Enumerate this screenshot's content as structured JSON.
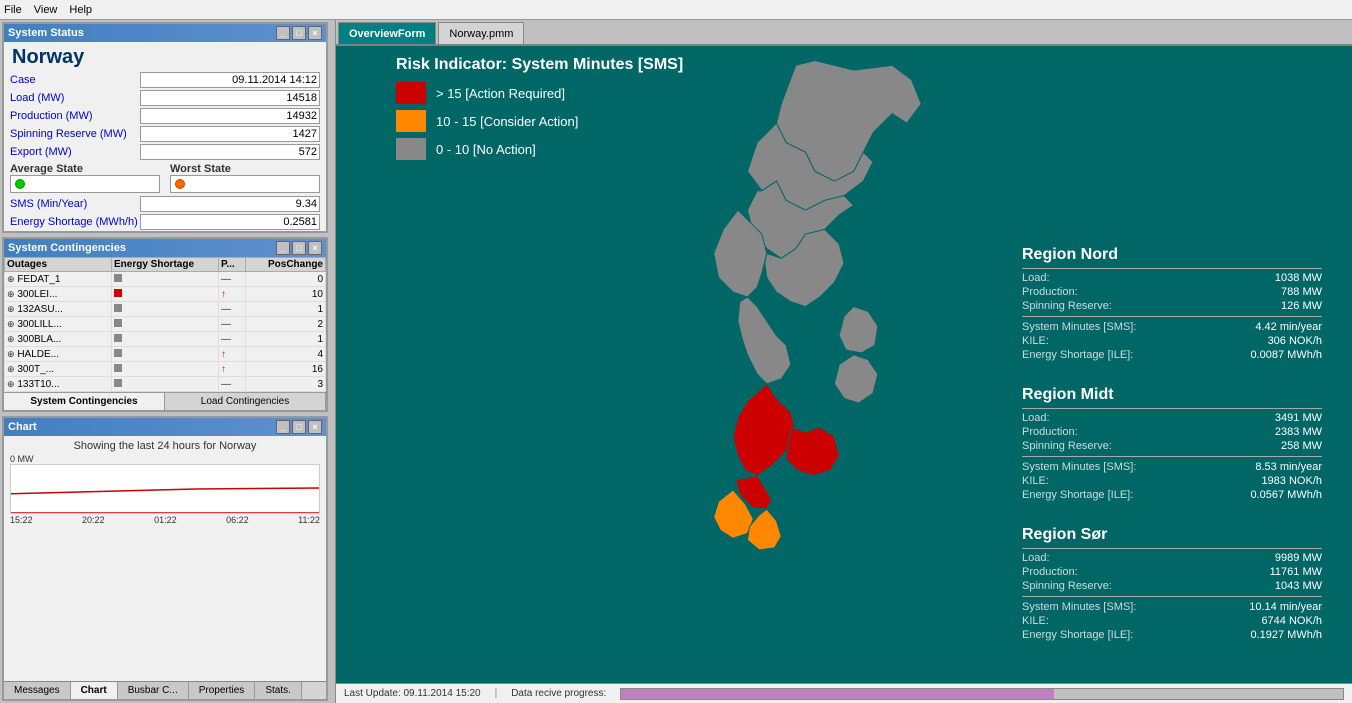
{
  "menubar": {
    "items": [
      "File",
      "View",
      "Help"
    ]
  },
  "systemStatus": {
    "title": "System Status",
    "regionTitle": "Norway",
    "fields": [
      {
        "label": "Case",
        "value": "09.11.2014 14:12"
      },
      {
        "label": "Load (MW)",
        "value": "14518"
      },
      {
        "label": "Production (MW)",
        "value": "14932"
      },
      {
        "label": "Spinning Reserve (MW)",
        "value": "1427"
      },
      {
        "label": "Export (MW)",
        "value": "572"
      }
    ],
    "averageStateLabel": "Average State",
    "worstStateLabel": "Worst State",
    "smsLabel": "SMS (Min/Year)",
    "smsValue": "9.34",
    "energyShortageLabel": "Energy Shortage (MWh/h)",
    "energyShortageValue": "0.2581"
  },
  "systemContingencies": {
    "title": "System Contingencies",
    "columns": [
      "Outages",
      "Energy Shortage",
      "P...",
      "PosChange"
    ],
    "rows": [
      {
        "name": "FEDAT_1",
        "bar": "gray",
        "arrow": "dash",
        "pos": "0",
        "expanded": true
      },
      {
        "name": "300LEI...",
        "bar": "small",
        "arrow": "up",
        "pos": "10"
      },
      {
        "name": "132ASU...",
        "bar": "gray",
        "arrow": "dash",
        "pos": "1"
      },
      {
        "name": "300LILL...",
        "bar": "gray",
        "arrow": "dash",
        "pos": "2"
      },
      {
        "name": "300BLA...",
        "bar": "gray",
        "arrow": "dash",
        "pos": "1"
      },
      {
        "name": "HALDE...",
        "bar": "gray",
        "arrow": "up",
        "pos": "4"
      },
      {
        "name": "300T_...",
        "bar": "gray",
        "arrow": "up",
        "pos": "16"
      },
      {
        "name": "133T10...",
        "bar": "gray",
        "arrow": "dash",
        "pos": "3"
      }
    ],
    "tabs": [
      "System Contingencies",
      "Load Contingencies"
    ]
  },
  "chart": {
    "title": "Chart",
    "subtitle": "Showing the last 24 hours for Norway",
    "mwLabel": "0 MW",
    "timeLabels": [
      "15:22",
      "20:22",
      "01:22",
      "06:22",
      "11:22"
    ]
  },
  "bottomTabs": [
    "Messages",
    "Chart",
    "Busbar C...",
    "Properties",
    "Stats."
  ],
  "mainTabs": [
    "OverviewForm",
    "Norway.pmm"
  ],
  "riskIndicator": {
    "title": "Risk Indicator:  System Minutes [SMS]",
    "items": [
      {
        "color": "red",
        "text": "> 15  [Action Required]"
      },
      {
        "color": "orange",
        "text": "10 - 15  [Consider Action]"
      },
      {
        "color": "gray",
        "text": "0 - 10  [No Action]"
      }
    ]
  },
  "regions": {
    "nord": {
      "title": "Region Nord",
      "load": "1038",
      "loadUnit": "MW",
      "production": "788",
      "productionUnit": "MW",
      "spinningReserve": "126",
      "spinningReserveUnit": "MW",
      "sms": "4.42",
      "smsUnit": "min/year",
      "kile": "306",
      "kileUnit": "NOK/h",
      "energyShortage": "0.0087",
      "energyShortageUnit": "MWh/h"
    },
    "midt": {
      "title": "Region Midt",
      "load": "3491",
      "loadUnit": "MW",
      "production": "2383",
      "productionUnit": "MW",
      "spinningReserve": "258",
      "spinningReserveUnit": "MW",
      "sms": "8.53",
      "smsUnit": "min/year",
      "kile": "1983",
      "kileUnit": "NOK/h",
      "energyShortage": "0.0567",
      "energyShortageUnit": "MWh/h"
    },
    "sor": {
      "title": "Region Sør",
      "load": "9989",
      "loadUnit": "MW",
      "production": "11761",
      "productionUnit": "MW",
      "spinningReserve": "1043",
      "spinningReserveUnit": "MW",
      "sms": "10.14",
      "smsUnit": "min/year",
      "kile": "6744",
      "kileUnit": "NOK/h",
      "energyShortage": "0.1927",
      "energyShortageUnit": "MWh/h"
    }
  },
  "statusBar": {
    "lastUpdate": "Last Update: 09.11.2014 15:20",
    "dataProgress": "Data recive progress:"
  }
}
